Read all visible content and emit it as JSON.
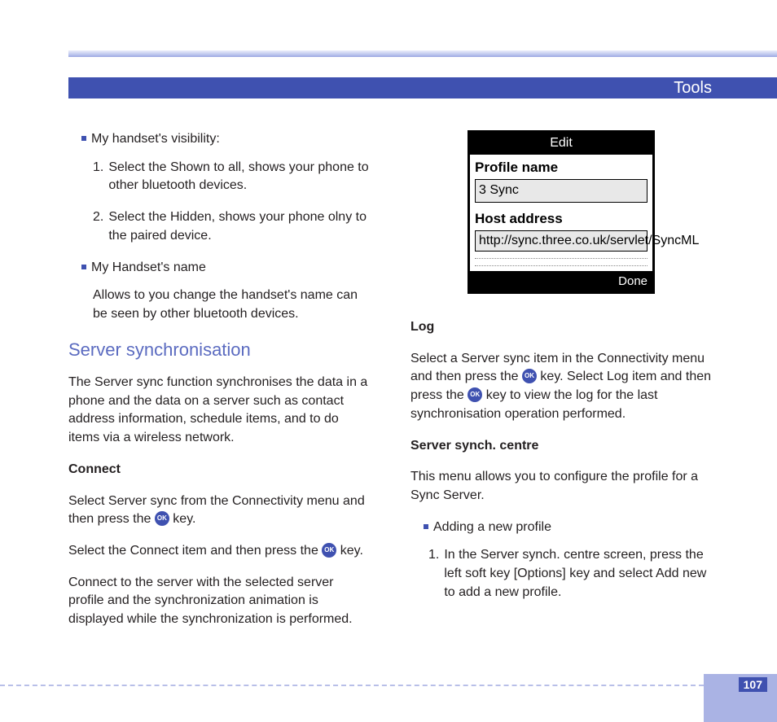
{
  "header": {
    "title": "Tools"
  },
  "left": {
    "bullet1": "My handset's visibility:",
    "num1": {
      "n": "1.",
      "t": "Select the Shown to all, shows your phone to other bluetooth devices."
    },
    "num2": {
      "n": "2.",
      "t": "Select the Hidden, shows your phone olny to the paired device."
    },
    "bullet2": "My Handset's name",
    "bullet2_desc": "Allows to you change the handset's name can be seen by other bluetooth devices.",
    "section": "Server synchronisation",
    "intro": "The Server sync function synchronises the data in a phone and the data on a server such as contact address information, schedule items, and to do items via a wireless network.",
    "connect_h": "Connect",
    "connect_p1a": "Select Server sync from the Connectivity menu and then press the ",
    "connect_p1b": " key.",
    "connect_p2a": "Select the Connect item and then press the ",
    "connect_p2b": " key.",
    "connect_p3": "Connect to the server with the selected server profile and the synchronization animation is displayed while the synchronization is performed."
  },
  "phone": {
    "title": "Edit",
    "label1": "Profile name",
    "field1": "3 Sync",
    "label2": "Host address",
    "field2": "http://sync.three.co.uk/servlet/SyncML",
    "softkey": "Done"
  },
  "right": {
    "log_h": "Log",
    "log_a": "Select a Server sync item in the Connectivity menu and then press the ",
    "log_b": " key. Select Log item and then press the ",
    "log_c": " key to view the log for the last synchronisation operation performed.",
    "centre_h": "Server synch. centre",
    "centre_p": "This menu allows you to configure the profile for a Sync Server.",
    "bullet": "Adding a new profile",
    "num1": {
      "n": "1.",
      "t": "In the Server synch. centre screen, press the left soft key [Options] key and select Add new to add a new profile."
    }
  },
  "ok": "OK",
  "page": "107"
}
